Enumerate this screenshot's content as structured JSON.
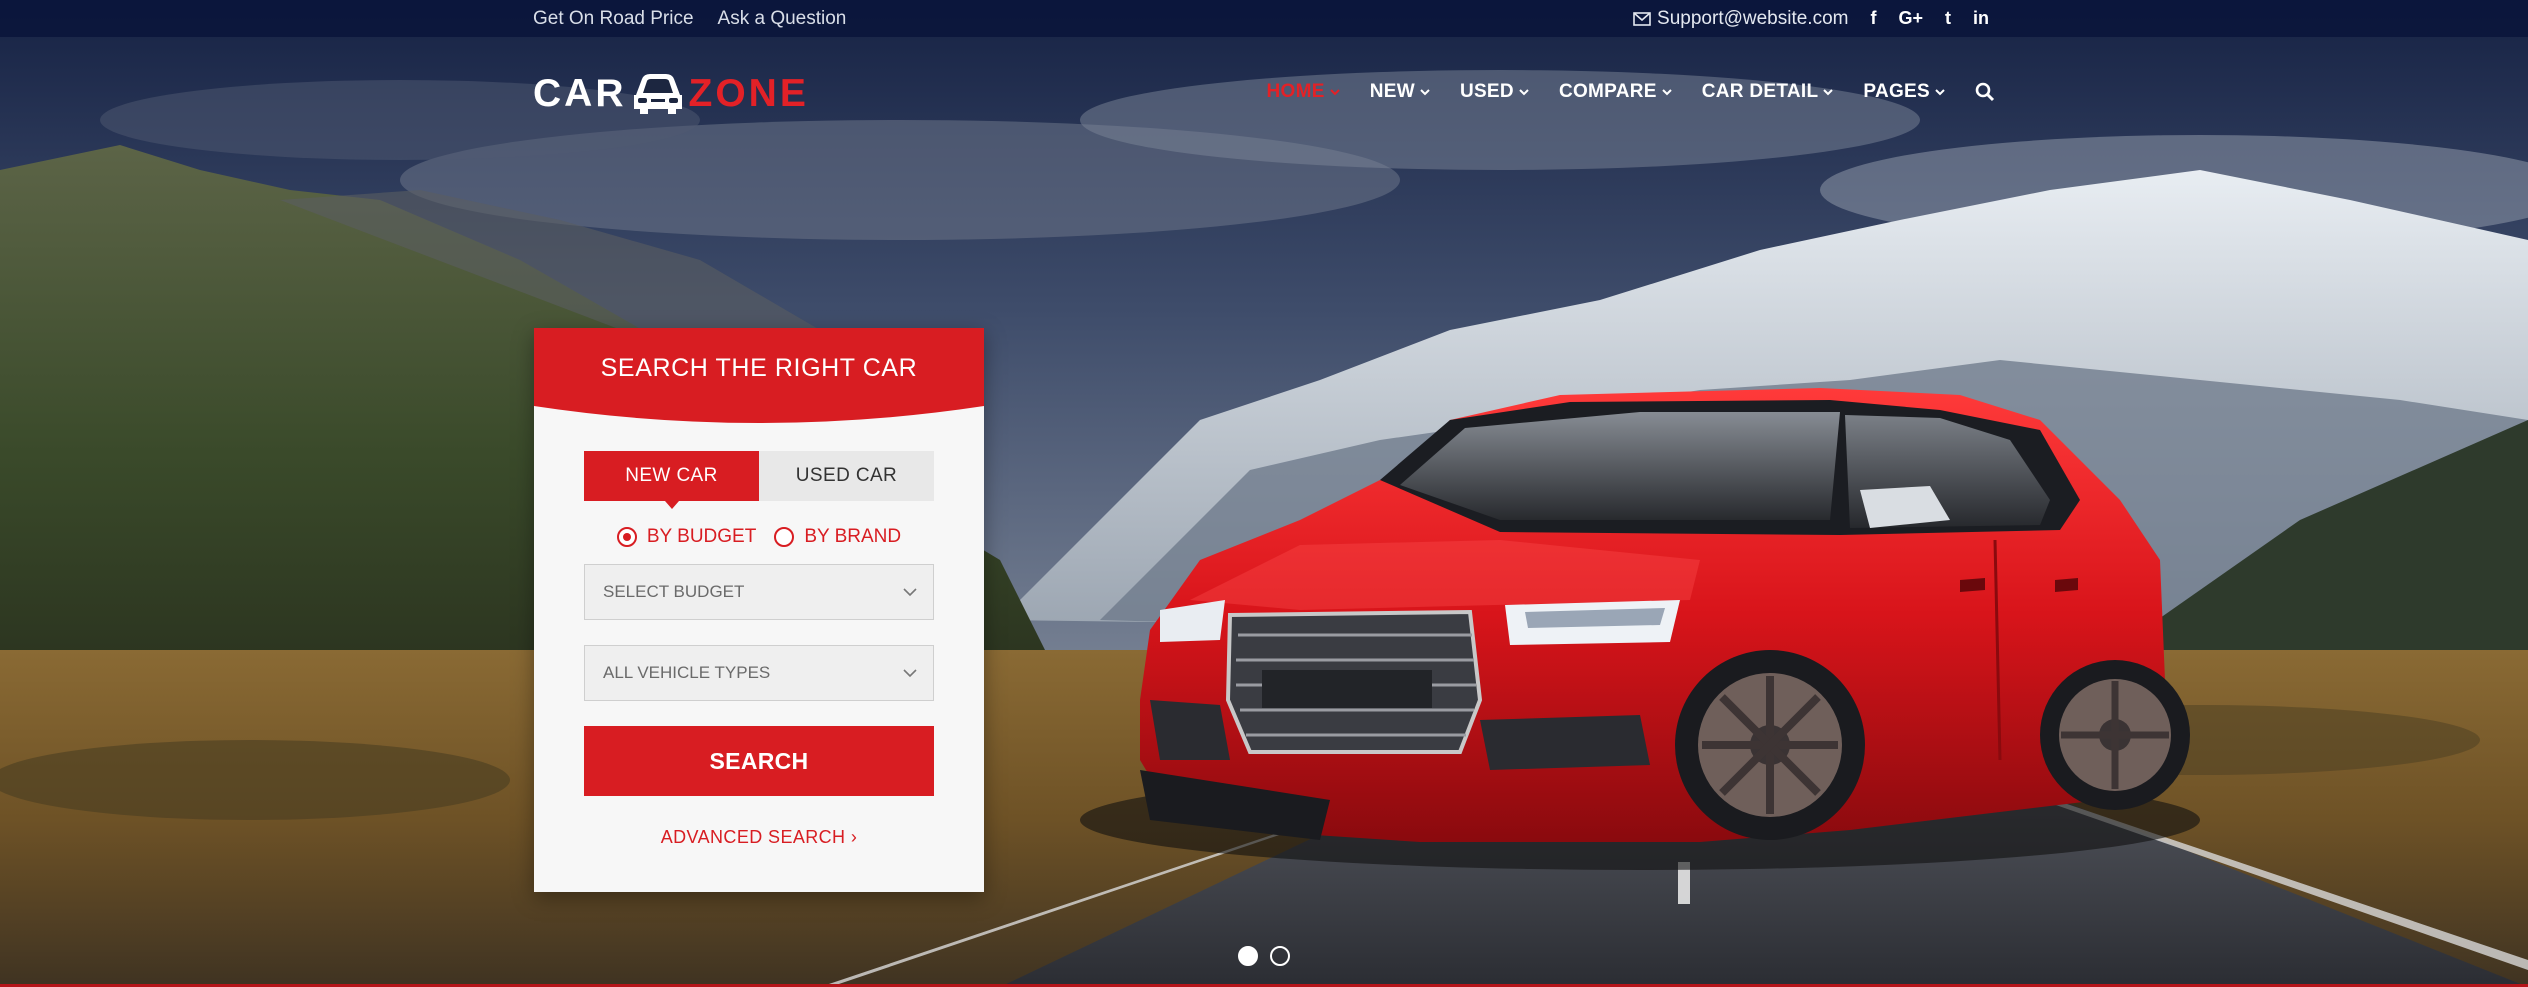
{
  "colors": {
    "brand_red": "#d81d22",
    "topbar_bg": "#0b163c",
    "panel_bg": "#f7f7f7"
  },
  "topbar": {
    "left_links": [
      "Get On Road Price",
      "Ask a Question"
    ],
    "email": "Support@website.com",
    "social": [
      {
        "icon": "facebook-icon",
        "glyph": "f"
      },
      {
        "icon": "google-plus-icon",
        "glyph": "G+"
      },
      {
        "icon": "twitter-icon",
        "glyph": "t"
      },
      {
        "icon": "linkedin-icon",
        "glyph": "in"
      }
    ]
  },
  "logo": {
    "part1": "CAR",
    "part2": "ZONE",
    "icon": "car-icon"
  },
  "nav": {
    "items": [
      {
        "label": "HOME",
        "active": true
      },
      {
        "label": "NEW",
        "active": false
      },
      {
        "label": "USED",
        "active": false
      },
      {
        "label": "COMPARE",
        "active": false
      },
      {
        "label": "CAR DETAIL",
        "active": false
      },
      {
        "label": "PAGES",
        "active": false
      }
    ],
    "search_icon": "search-icon"
  },
  "search_panel": {
    "title": "SEARCH THE RIGHT CAR",
    "tabs": [
      {
        "label": "NEW CAR",
        "active": true
      },
      {
        "label": "USED CAR",
        "active": false
      }
    ],
    "radios": [
      {
        "label": "BY BUDGET",
        "checked": true
      },
      {
        "label": "BY BRAND",
        "checked": false
      }
    ],
    "budget_select": "SELECT BUDGET",
    "vehicle_select": "ALL VEHICLE TYPES",
    "search_button": "SEARCH",
    "advanced_link": "ADVANCED SEARCH ›"
  },
  "slider": {
    "count": 2,
    "active_index": 0
  }
}
